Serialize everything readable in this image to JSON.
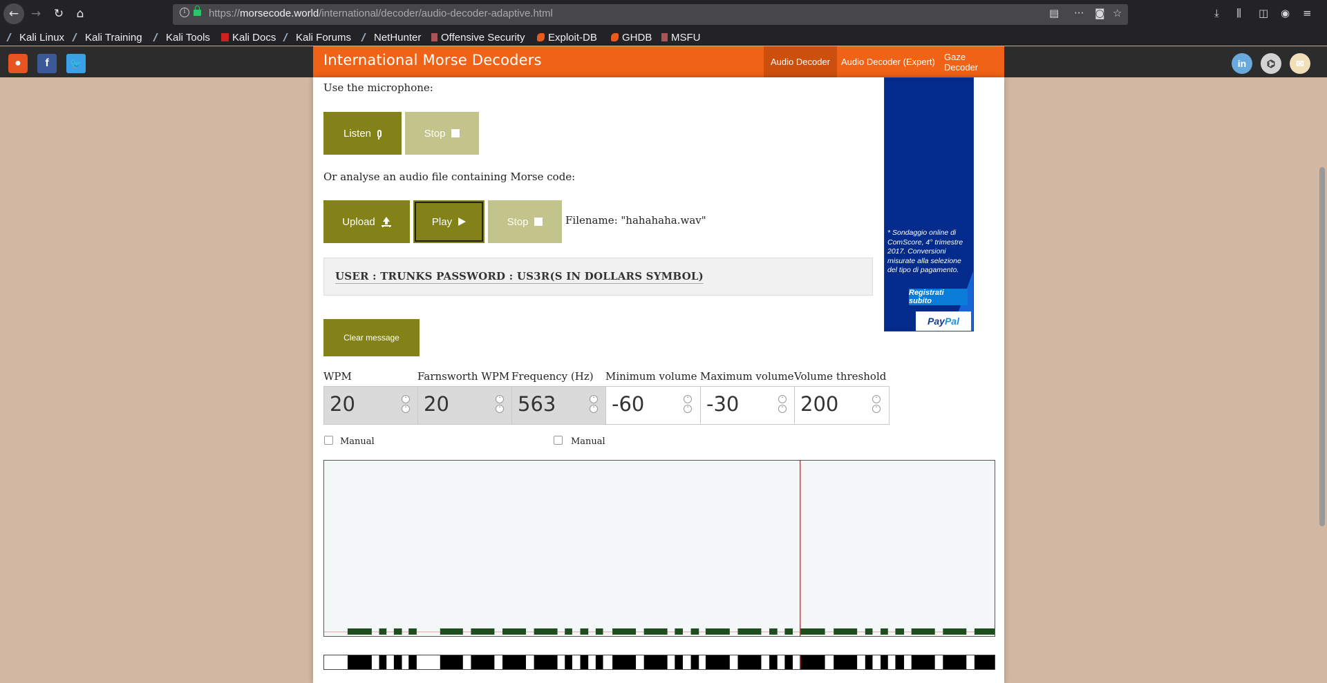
{
  "browser": {
    "url_prefix": "https://",
    "url_host": "morsecode.world",
    "url_path": "/international/decoder/audio-decoder-adaptive.html",
    "bookmarks": [
      "Kali Linux",
      "Kali Training",
      "Kali Tools",
      "Kali Docs",
      "Kali Forums",
      "NetHunter",
      "Offensive Security",
      "Exploit-DB",
      "GHDB",
      "MSFU"
    ]
  },
  "header": {
    "title": "International Morse Decoders",
    "tabs": [
      "Audio Decoder",
      "Audio Decoder (Expert)",
      "Gaze Decoder"
    ],
    "active_tab": "Audio Decoder",
    "accent_color": "#f06216"
  },
  "mic": {
    "prompt": "Use the microphone:",
    "listen_label": "Listen",
    "stop_label": "Stop"
  },
  "file": {
    "prompt": "Or analyse an audio file containing Morse code:",
    "upload_label": "Upload",
    "play_label": "Play",
    "stop_label": "Stop",
    "filename_text": "Filename: \"hahahaha.wav\""
  },
  "message": {
    "text": "USER : TRUNKS PASSWORD : US3R(S IN DOLLARS SYMBOL)",
    "clear_label": "Clear message"
  },
  "ad": {
    "disclaimer": "* Sondaggio online di ComScore, 4° trimestre 2017. Conversioni misurate alla selezione del tipo di pagamento.",
    "cta": "Registrati subito",
    "brand_a": "Pay",
    "brand_b": "Pal"
  },
  "settings": {
    "wpm": {
      "label": "WPM",
      "value": "20",
      "manual_label": "Manual"
    },
    "farnsworth": {
      "label": "Farnsworth WPM",
      "value": "20"
    },
    "frequency": {
      "label": "Frequency (Hz)",
      "value": "563",
      "manual_label": "Manual"
    },
    "min_volume": {
      "label": "Minimum volume",
      "value": "-60"
    },
    "max_volume": {
      "label": "Maximum volume",
      "value": "-30"
    },
    "threshold": {
      "label": "Volume threshold",
      "value": "200"
    }
  },
  "signal": {
    "morse_elements": [
      {
        "start": 0.035,
        "end": 0.071
      },
      {
        "start": 0.082,
        "end": 0.093
      },
      {
        "start": 0.104,
        "end": 0.116
      },
      {
        "start": 0.126,
        "end": 0.138
      },
      {
        "start": 0.173,
        "end": 0.207
      },
      {
        "start": 0.219,
        "end": 0.254
      },
      {
        "start": 0.266,
        "end": 0.301
      },
      {
        "start": 0.313,
        "end": 0.348
      },
      {
        "start": 0.359,
        "end": 0.37
      },
      {
        "start": 0.382,
        "end": 0.394
      },
      {
        "start": 0.405,
        "end": 0.416
      },
      {
        "start": 0.43,
        "end": 0.465
      },
      {
        "start": 0.477,
        "end": 0.512
      },
      {
        "start": 0.523,
        "end": 0.535
      },
      {
        "start": 0.547,
        "end": 0.559
      },
      {
        "start": 0.569,
        "end": 0.605
      },
      {
        "start": 0.617,
        "end": 0.652
      },
      {
        "start": 0.664,
        "end": 0.676
      },
      {
        "start": 0.687,
        "end": 0.699
      },
      {
        "start": 0.71,
        "end": 0.747
      },
      {
        "start": 0.76,
        "end": 0.795
      },
      {
        "start": 0.807,
        "end": 0.818
      },
      {
        "start": 0.83,
        "end": 0.841
      },
      {
        "start": 0.852,
        "end": 0.865
      },
      {
        "start": 0.876,
        "end": 0.911
      },
      {
        "start": 0.923,
        "end": 0.958
      },
      {
        "start": 0.97,
        "end": 1.0
      }
    ],
    "playhead": 0.71,
    "signal_color": "#1e4d1e",
    "playhead_color": "#e83030"
  }
}
